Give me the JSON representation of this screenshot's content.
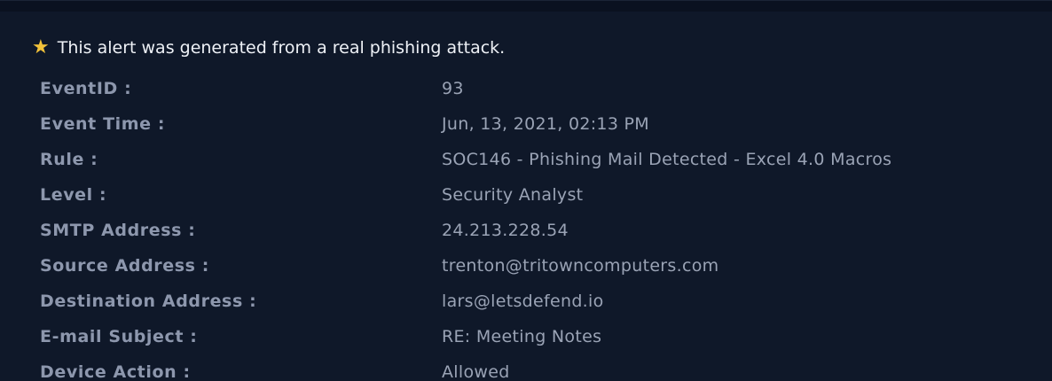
{
  "notice": {
    "icon": "star-icon",
    "icon_color": "#f2c23a",
    "text": "This alert was generated from a real phishing attack."
  },
  "details": [
    {
      "label": "EventID :",
      "value": "93"
    },
    {
      "label": "Event Time :",
      "value": "Jun, 13, 2021, 02:13 PM"
    },
    {
      "label": "Rule :",
      "value": "SOC146 - Phishing Mail Detected - Excel 4.0 Macros"
    },
    {
      "label": "Level :",
      "value": "Security Analyst"
    },
    {
      "label": "SMTP Address :",
      "value": "24.213.228.54"
    },
    {
      "label": "Source Address :",
      "value": "trenton@tritowncomputers.com"
    },
    {
      "label": "Destination Address :",
      "value": "lars@letsdefend.io"
    },
    {
      "label": "E-mail Subject :",
      "value": "RE: Meeting Notes"
    },
    {
      "label": "Device Action :",
      "value": "Allowed"
    }
  ]
}
